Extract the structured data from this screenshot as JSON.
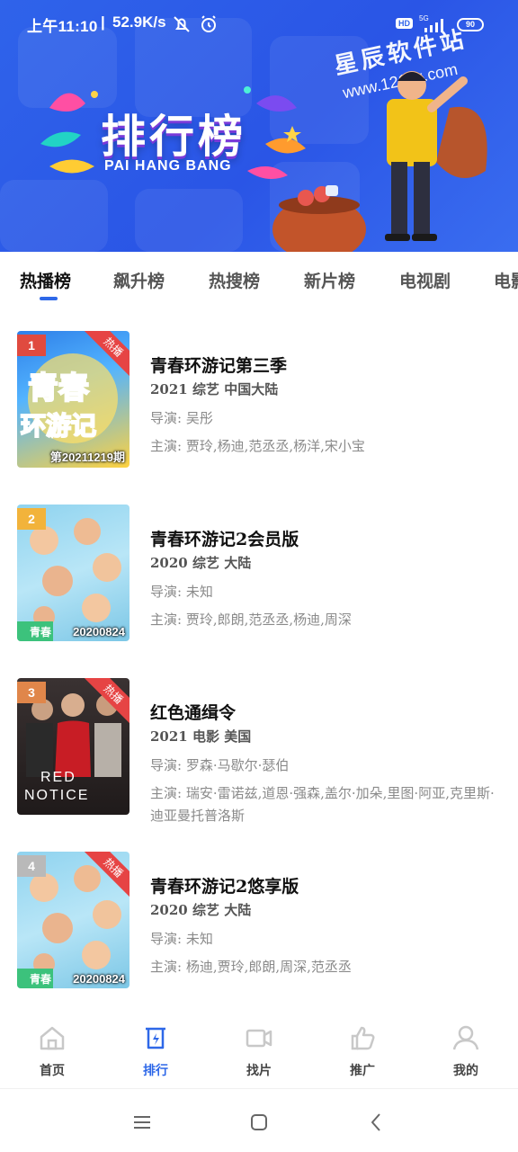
{
  "status": {
    "time": "上午11:10",
    "separator": "|",
    "speed": "52.9K/s",
    "hd": "HD",
    "network": "5G",
    "battery": "90"
  },
  "banner": {
    "title": "排行榜",
    "subtitle": "PAI HANG BANG",
    "watermark_cn": "星辰软件站",
    "watermark_url": "www.121xx.com",
    "colors": {
      "bg": "#2f63ea",
      "accent": "#2e68e8"
    }
  },
  "tabs": [
    {
      "label": "热播榜",
      "active": true
    },
    {
      "label": "飙升榜",
      "active": false
    },
    {
      "label": "热搜榜",
      "active": false
    },
    {
      "label": "新片榜",
      "active": false
    },
    {
      "label": "电视剧",
      "active": false
    },
    {
      "label": "电影",
      "active": false
    }
  ],
  "list": [
    {
      "rank": "1",
      "rank_color": "#e04a3f",
      "hot": "热播",
      "poster_text": "第20211219期",
      "poster_art": "青春环游记",
      "title": "青春环游记第三季",
      "meta": "2021  综艺  中国大陆",
      "director": "导演: 吴彤",
      "cast": "主演: 贾玲,杨迪,范丞丞,杨洋,宋小宝"
    },
    {
      "rank": "2",
      "rank_color": "#f2b33b",
      "hot": "",
      "poster_text": "20200824",
      "poster_art": "青春",
      "title": "青春环游记2会员版",
      "meta": "2020  综艺  大陆",
      "director": "导演: 未知",
      "cast": "主演: 贾玲,郎朗,范丞丞,杨迪,周深"
    },
    {
      "rank": "3",
      "rank_color": "#e0864a",
      "hot": "热播",
      "poster_text": "",
      "poster_art": "RED NOTICE",
      "title": "红色通缉令",
      "meta": "2021  电影  美国",
      "director": "导演: 罗森·马歇尔·瑟伯",
      "cast": "主演: 瑞安·雷诺兹,道恩·强森,盖尔·加朵,里图·阿亚,克里斯·迪亚曼托普洛斯"
    },
    {
      "rank": "4",
      "rank_color": "#b9b9b9",
      "hot": "热播",
      "poster_text": "20200824",
      "poster_art": "青春",
      "title": "青春环游记2悠享版",
      "meta": "2020  综艺  大陆",
      "director": "导演: 未知",
      "cast": "主演: 杨迪,贾玲,郎朗,周深,范丞丞"
    }
  ],
  "bottom_nav": [
    {
      "label": "首页",
      "icon": "home-icon",
      "active": false
    },
    {
      "label": "排行",
      "icon": "ranking-icon",
      "active": true
    },
    {
      "label": "找片",
      "icon": "video-icon",
      "active": false
    },
    {
      "label": "推广",
      "icon": "thumbs-up-icon",
      "active": false
    },
    {
      "label": "我的",
      "icon": "user-icon",
      "active": false
    }
  ]
}
